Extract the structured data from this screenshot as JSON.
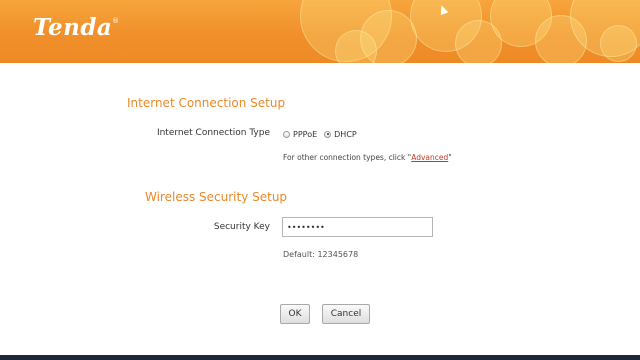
{
  "header": {
    "logo_text": "Tenda",
    "logo_mark": "®",
    "brand_color": "#f0902a"
  },
  "internet_setup": {
    "title": "Internet Connection Setup",
    "connection_type_label": "Internet Connection Type",
    "options": [
      {
        "label": "PPPoE",
        "selected": false
      },
      {
        "label": "DHCP",
        "selected": true
      }
    ],
    "hint_prefix": "For other connection types, click \"",
    "hint_link": "Advanced",
    "hint_suffix": "\""
  },
  "wireless_setup": {
    "title": "Wireless Security Setup",
    "security_key_label": "Security Key",
    "security_key_value": "12345678",
    "default_text": "Default: 12345678"
  },
  "actions": {
    "ok_label": "OK",
    "cancel_label": "Cancel"
  },
  "colors": {
    "section_title": "#e8892a",
    "link": "#c0392b"
  }
}
